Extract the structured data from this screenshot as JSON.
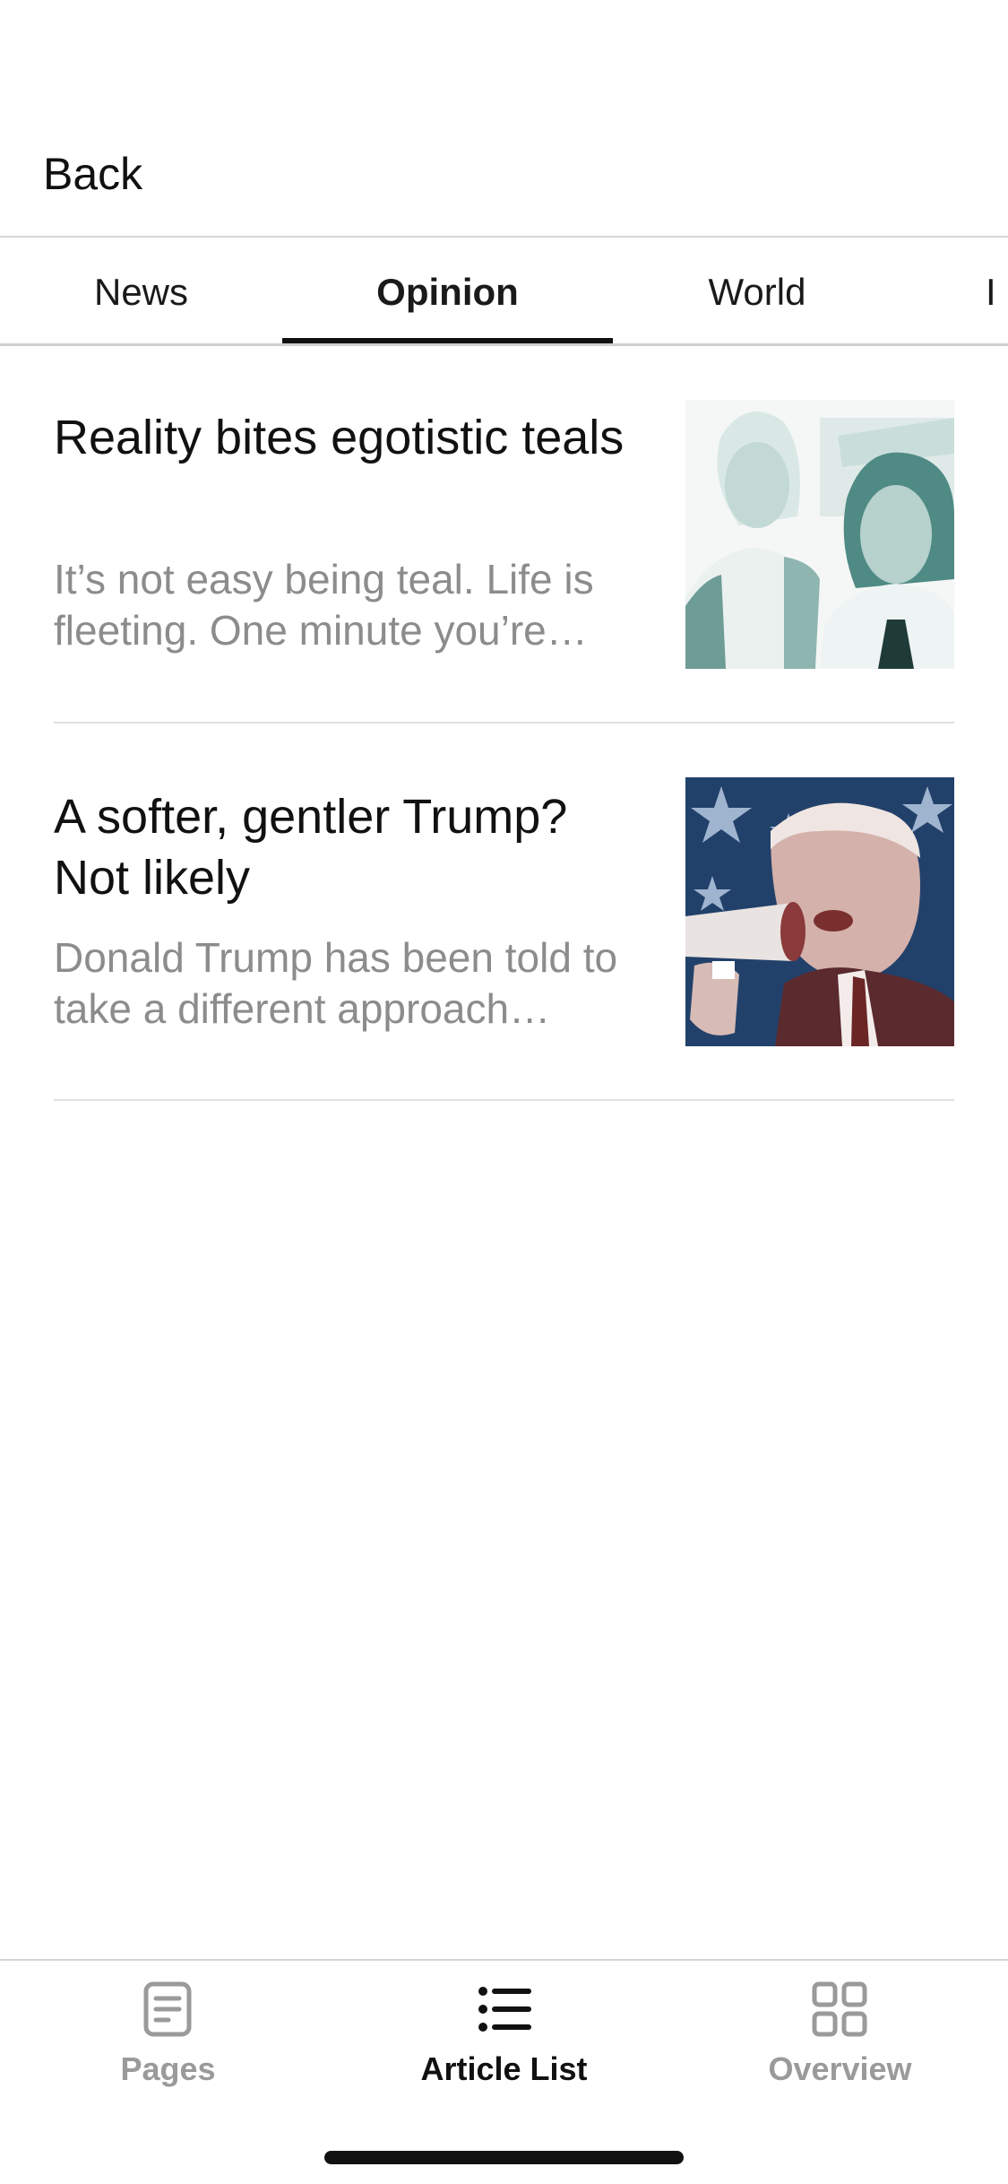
{
  "header": {
    "back_label": "Back"
  },
  "tabs": [
    {
      "label": "News",
      "active": false
    },
    {
      "label": "Opinion",
      "active": true
    },
    {
      "label": "World",
      "active": false
    },
    {
      "label": "I",
      "active": false
    }
  ],
  "articles": [
    {
      "title": "Reality bites egotistic teals",
      "summary": "It’s not easy being teal. Life is fleeting. One minute you’re…",
      "image": "two-women-teal-photo"
    },
    {
      "title": "A softer, gentler Trump? Not likely",
      "summary": "Donald Trump has been told to take a different approach…",
      "image": "trump-megaphone-flag-photo"
    }
  ],
  "tabbar": {
    "items": [
      {
        "label": "Pages",
        "icon": "document-icon",
        "active": false
      },
      {
        "label": "Article List",
        "icon": "list-icon",
        "active": true
      },
      {
        "label": "Overview",
        "icon": "grid-icon",
        "active": false
      }
    ]
  },
  "colors": {
    "accent": "#111111",
    "muted": "#8c8c8c",
    "divider": "#e0e0e0"
  }
}
